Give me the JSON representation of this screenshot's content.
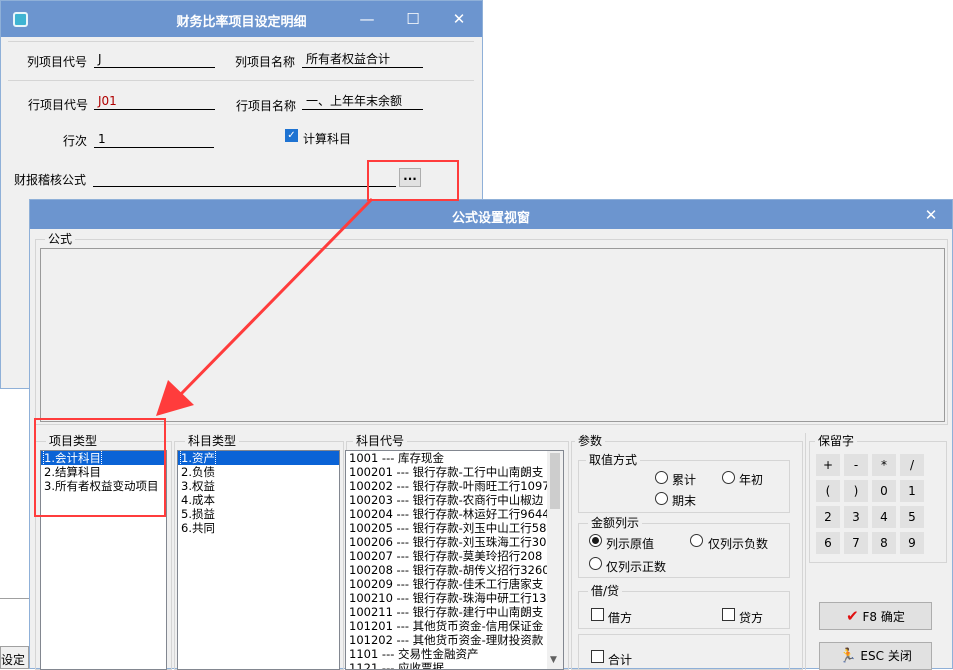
{
  "back_window": {
    "title": "财务比率项目设定明细",
    "controls": {
      "minimize": "—",
      "maximize": "☐",
      "close": "✕"
    },
    "col_code_label": "列项目代号",
    "col_code_value": "J",
    "col_name_label": "列项目名称",
    "col_name_value": "所有者权益合计",
    "row_code_label": "行项目代号",
    "row_code_value": "J01",
    "row_name_label": "行项目名称",
    "row_name_value": "一、上年年末余额",
    "row_order_label": "行次",
    "row_order_value": "1",
    "calc_subject_label": "计算科目",
    "calc_subject_checked": true,
    "audit_formula_label": "财报稽核公式",
    "audit_formula_value": "",
    "ellipsis_label": "...",
    "bottom_fragment": "设定"
  },
  "dialog": {
    "title": "公式设置视窗",
    "close_glyph": "✕",
    "formula_group_label": "公式",
    "formula_value": "",
    "item_type": {
      "label": "项目类型",
      "items": [
        "1.会计科目",
        "2.结算科目",
        "3.所有者权益变动项目"
      ],
      "selected": 0
    },
    "subject_type": {
      "label": "科目类型",
      "items": [
        "1.资产",
        "2.负债",
        "3.权益",
        "4.成本",
        "5.损益",
        "6.共同"
      ],
      "selected": 0
    },
    "subject_code": {
      "label": "科目代号",
      "items": [
        "1001 --- 库存现金",
        "100201 --- 银行存款-工行中山南朗支",
        "100202 --- 银行存款-叶雨旺工行1097",
        "100203 --- 银行存款-农商行中山椒边",
        "100204 --- 银行存款-林运好工行9644",
        "100205 --- 银行存款-刘玉中山工行58",
        "100206 --- 银行存款-刘玉珠海工行30",
        "100207 --- 银行存款-莫美玲招行208",
        "100208 --- 银行存款-胡传义招行3260",
        "100209 --- 银行存款-佳禾工行唐家支",
        "100210 --- 银行存款-珠海中研工行13",
        "100211 --- 银行存款-建行中山南朗支",
        "101201 --- 其他货币资金-信用保证金",
        "101202 --- 其他货币资金-理财投资款",
        "1101 --- 交易性金融资产",
        "1121 --- 应收票据"
      ]
    },
    "params": {
      "label": "参数",
      "value_mode": {
        "label": "取值方式",
        "options": [
          "累计",
          "年初",
          "期末"
        ],
        "selected": null
      },
      "amount_display": {
        "label": "金额列示",
        "options": [
          "列示原值",
          "仅列示负数",
          "仅列示正数"
        ],
        "selected": 0
      },
      "debit_credit": {
        "label": "借/贷",
        "debit_label": "借方",
        "credit_label": "贷方"
      },
      "total_label": "合计"
    },
    "reserved": {
      "label": "保留字",
      "keys": [
        "+",
        "-",
        "*",
        "/",
        "(",
        ")",
        "0",
        "1",
        "2",
        "3",
        "4",
        "5",
        "6",
        "7",
        "8",
        "9"
      ]
    },
    "confirm_label": "F8 确定",
    "close_label": "ESC 关闭"
  },
  "colors": {
    "titlebar": "#6c95cf",
    "selection": "#0a63d6",
    "annotation": "#ff3c3c"
  }
}
